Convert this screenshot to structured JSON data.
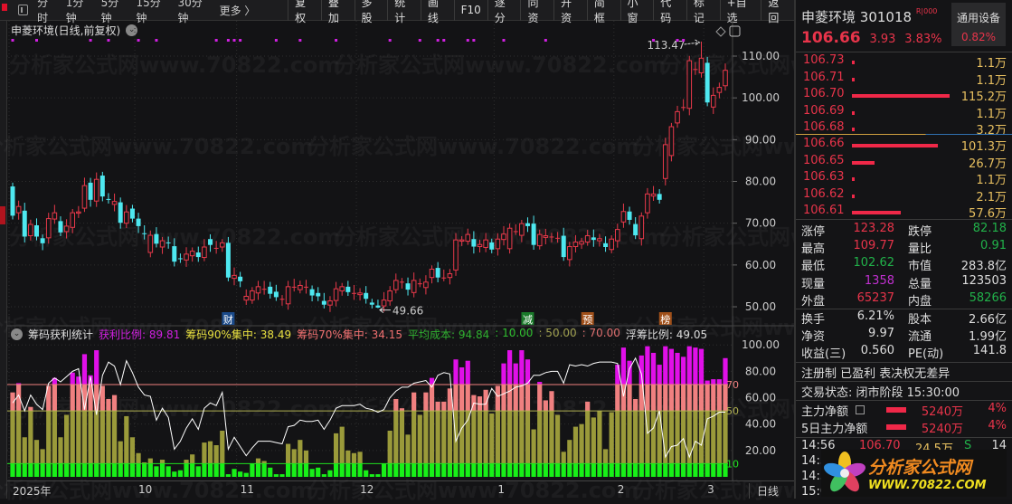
{
  "toolbar": {
    "periods": [
      "分时",
      "1分钟",
      "5分钟",
      "15分钟",
      "30分钟",
      "更多 〉"
    ],
    "buttons": [
      "复权",
      "叠加",
      "多股",
      "统计",
      "画线",
      "F10",
      "逐分",
      "同资",
      "开资",
      "简框",
      "小窗",
      "代码",
      "标记",
      "+自选",
      "返回"
    ]
  },
  "chart": {
    "title": "申菱环境(日线,前复权)",
    "y_ticks": [
      "110.00",
      "100.00",
      "90.00",
      "80.00",
      "70.00",
      "60.00",
      "50.00"
    ],
    "high_label": "113.47",
    "low_label": "49.66",
    "markers": [
      {
        "text": "财",
        "color": "#1a4a8a",
        "index": 36
      },
      {
        "text": "减",
        "color": "#1a7a2a",
        "index": 86
      },
      {
        "text": "预",
        "color": "#a0501a",
        "index": 96
      },
      {
        "text": "榜",
        "color": "#a0501a",
        "index": 109
      }
    ],
    "watermark": "分析家公式网www.70822.com"
  },
  "chart_data": [
    {
      "type": "candlestick",
      "title": "申菱环境(日线,前复权)",
      "ylim": [
        47,
        116
      ],
      "y_ticks": [
        110,
        100,
        90,
        80,
        70,
        60,
        50
      ],
      "ohlc_open_close": [
        [
          78.8,
          71.8
        ],
        [
          72.5,
          74
        ],
        [
          73,
          66.8
        ],
        [
          67,
          69.7
        ],
        [
          69.5,
          66.8
        ],
        [
          66.4,
          65.2
        ],
        [
          66.5,
          71.1
        ],
        [
          71,
          72.5
        ],
        [
          70.5,
          67.8
        ],
        [
          68,
          69.3
        ],
        [
          69,
          72.5
        ],
        [
          72.4,
          72.7
        ],
        [
          73.6,
          79
        ],
        [
          79.7,
          75.6
        ],
        [
          75.3,
          80.5
        ],
        [
          81.4,
          76.4
        ],
        [
          75.8,
          75.6
        ],
        [
          74.5,
          75.2
        ],
        [
          75,
          70.1
        ],
        [
          70,
          72.7
        ],
        [
          73.5,
          71.1
        ],
        [
          71.1,
          69.3
        ],
        [
          67.6,
          67.5
        ],
        [
          63,
          67.1
        ],
        [
          67.4,
          65.1
        ],
        [
          64.3,
          65.8
        ],
        [
          65.4,
          65.3
        ],
        [
          64.5,
          60.8
        ],
        [
          61.6,
          61.4
        ],
        [
          61.2,
          62.6
        ],
        [
          62.2,
          63.3
        ],
        [
          63,
          61.9
        ],
        [
          61.8,
          64.3
        ],
        [
          66.2,
          64.8
        ],
        [
          64.1,
          64.1
        ],
        [
          64.3,
          65.3
        ],
        [
          65.3,
          57
        ],
        [
          56.8,
          57.5
        ],
        [
          57.2,
          56.1
        ],
        [
          51.6,
          52.5
        ],
        [
          51.6,
          53.8
        ],
        [
          53.3,
          54.8
        ],
        [
          54.3,
          54.3
        ],
        [
          54.8,
          53.1
        ],
        [
          53.6,
          52.3
        ],
        [
          51.9,
          51.9
        ],
        [
          50.7,
          54.8
        ],
        [
          54.8,
          54.8
        ],
        [
          54.1,
          55.1
        ],
        [
          54.8,
          54.8
        ],
        [
          54.2,
          52.7
        ],
        [
          53.3,
          52.5
        ],
        [
          51.4,
          50.5
        ],
        [
          50.4,
          51.4
        ],
        [
          51.5,
          54.3
        ],
        [
          53.8,
          54.8
        ],
        [
          54.8,
          53.5
        ],
        [
          53.3,
          53.3
        ],
        [
          52.9,
          53.3
        ],
        [
          53.3,
          51.9
        ],
        [
          51.0,
          50.5
        ],
        [
          50.3,
          49.8
        ],
        [
          50.2,
          51.6
        ],
        [
          51.4,
          53.8
        ],
        [
          54.1,
          56.3
        ],
        [
          56,
          56
        ],
        [
          55.6,
          54.1
        ],
        [
          53.4,
          56.3
        ],
        [
          55.6,
          55.6
        ],
        [
          54.6,
          55.9
        ],
        [
          57,
          59
        ],
        [
          59.3,
          57
        ],
        [
          57,
          57
        ],
        [
          57,
          57.9
        ],
        [
          58.8,
          66
        ],
        [
          65.7,
          66
        ],
        [
          65.7,
          67.3
        ],
        [
          66.2,
          64.4
        ],
        [
          64.4,
          64.9
        ],
        [
          64.2,
          66
        ],
        [
          65.4,
          63.7
        ],
        [
          63.9,
          66.2
        ],
        [
          66.1,
          67.4
        ],
        [
          63.9,
          68.8
        ],
        [
          68.1,
          68.1
        ],
        [
          67.1,
          69.9
        ],
        [
          70,
          69.3
        ],
        [
          69.9,
          64.8
        ],
        [
          64.6,
          67.3
        ],
        [
          66.6,
          67
        ],
        [
          66.8,
          66.8
        ],
        [
          66.5,
          66.5
        ],
        [
          67,
          61.9
        ],
        [
          61.3,
          64.4
        ],
        [
          64.4,
          65.5
        ],
        [
          65,
          65.6
        ],
        [
          65.5,
          67
        ],
        [
          66.6,
          66
        ],
        [
          65.8,
          66.3
        ],
        [
          65.2,
          64.3
        ],
        [
          63.7,
          66.2
        ],
        [
          65.8,
          68.5
        ],
        [
          70.3,
          72.8
        ],
        [
          72.8,
          70.8
        ],
        [
          69.8,
          67.1
        ],
        [
          66.3,
          71.7
        ],
        [
          72.5,
          77
        ],
        [
          76.5,
          77
        ],
        [
          77,
          75.6
        ],
        [
          80.7,
          88.8
        ],
        [
          86.2,
          93.1
        ],
        [
          94,
          96.7
        ],
        [
          97.8,
          97.8
        ],
        [
          97.5,
          108.9
        ],
        [
          106.9,
          106.9
        ],
        [
          106,
          109.5
        ],
        [
          108.4,
          98.9
        ],
        [
          97.8,
          100.6
        ],
        [
          101.3,
          102.5
        ],
        [
          102.9,
          106.6
        ]
      ],
      "max_high": {
        "index": 115,
        "value": 113.47
      },
      "min_low": {
        "index": 61,
        "value": 49.66
      },
      "signal_indices": [
        0,
        4,
        13,
        16,
        21,
        24,
        34,
        36,
        37,
        38,
        44,
        48,
        54,
        63,
        68,
        71,
        72,
        76,
        77,
        82,
        89,
        107,
        111,
        112
      ],
      "x_labels": [
        {
          "text": "2025年",
          "index": 0
        },
        {
          "text": "10",
          "index": 21
        },
        {
          "text": "11",
          "index": 38
        },
        {
          "text": "12",
          "index": 58
        },
        {
          "text": "1",
          "index": 81
        },
        {
          "text": "2",
          "index": 101
        },
        {
          "text": "3",
          "index": 116
        }
      ],
      "period_label": "日线"
    },
    {
      "type": "bar+line",
      "title": "筹码获利统计",
      "ylim": [
        0,
        105
      ],
      "y_ticks": [
        "100.00",
        "80.00",
        "60.00",
        "40.00",
        "20.00"
      ],
      "ref_lines": [
        {
          "value": 70,
          "label": "70",
          "color": "#f08080"
        },
        {
          "value": 50,
          "label": "50",
          "color": "#b0b050"
        },
        {
          "value": 10,
          "label": "10",
          "color": "#20e020"
        }
      ],
      "bar_values": [
        64,
        71,
        30,
        53,
        28,
        21,
        69,
        75,
        30,
        47,
        79,
        76,
        93,
        77,
        96,
        69,
        59,
        62,
        27,
        46,
        30,
        18,
        11,
        14,
        8,
        13,
        8,
        4,
        5,
        13,
        17,
        8,
        26,
        27,
        24,
        35,
        2,
        6,
        4,
        3,
        10,
        14,
        12,
        7,
        2,
        2,
        25,
        21,
        28,
        20,
        6,
        7,
        2,
        5,
        33,
        38,
        20,
        18,
        19,
        5,
        2,
        2,
        10,
        35,
        59,
        52,
        32,
        64,
        47,
        64,
        75,
        57,
        57,
        67,
        89,
        83,
        88,
        62,
        61,
        66,
        48,
        69,
        86,
        96,
        86,
        96,
        89,
        36,
        72,
        58,
        65,
        47,
        19,
        28,
        38,
        40,
        57,
        45,
        50,
        21,
        49,
        85,
        98,
        88,
        59,
        92,
        99,
        94,
        85,
        99,
        97,
        94,
        91,
        99,
        98,
        97,
        73,
        74,
        74,
        90
      ],
      "line_values": [
        56,
        62,
        50,
        62,
        55,
        51,
        71,
        75,
        72,
        76,
        80,
        82,
        51,
        76,
        47,
        77,
        87,
        84,
        70,
        88,
        79,
        68,
        62,
        61,
        43,
        52,
        45,
        21,
        27,
        37,
        44,
        36,
        52,
        56,
        54,
        64,
        21,
        30,
        23,
        16,
        22,
        27,
        27,
        27,
        26,
        25,
        38,
        39,
        43,
        42,
        42,
        43,
        36,
        43,
        52,
        54,
        54,
        54,
        55,
        52,
        51,
        49,
        51,
        60,
        65,
        68,
        68,
        71,
        72,
        73,
        68,
        77,
        79,
        78,
        27,
        37,
        43,
        56,
        55,
        55,
        67,
        61,
        63,
        65,
        68,
        69,
        71,
        77,
        77,
        79,
        80,
        80,
        71,
        85,
        84,
        85,
        84,
        86,
        87,
        87,
        87,
        86,
        61,
        82,
        90,
        78,
        33,
        37,
        50,
        15,
        23,
        24,
        29,
        15,
        27,
        24,
        44,
        46,
        49,
        49
      ],
      "colors": {
        "green": "#18f018",
        "olive": "#9a9a3a",
        "salmon": "#f08080",
        "magenta": "#e010e8",
        "line": "#ffffff"
      }
    }
  ],
  "indicator": {
    "name": "筹码获利统计",
    "items": [
      {
        "label": "获利比例: 89.81",
        "color": "#d020e0"
      },
      {
        "label": "筹码90%集中: 38.49",
        "color": "#e8e040"
      },
      {
        "label": "筹码70%集中: 34.15",
        "color": "#f07070"
      },
      {
        "label": "平均成本: 94.84",
        "color": "#30b030"
      },
      {
        "label": ": 10.00",
        "color": "#30c030"
      },
      {
        "label": ": 50.00",
        "color": "#a0a050"
      },
      {
        "label": ": 70.00",
        "color": "#e07070"
      },
      {
        "label": "浮筹比例: 49.05",
        "color": "#dddddd"
      }
    ]
  },
  "quote": {
    "name": "申菱环境",
    "code": "301018",
    "badge": "R|000",
    "sector": "通用设备",
    "sector_change": "0.82%",
    "price": "106.66",
    "change": "3.93",
    "change_pct": "3.83%",
    "asks": [
      {
        "price": "106.73",
        "vol": "1.1万",
        "ratio": 0.01
      },
      {
        "price": "106.71",
        "vol": "1.1万",
        "ratio": 0.01
      },
      {
        "price": "106.70",
        "vol": "115.2万",
        "ratio": 1.0
      },
      {
        "price": "106.69",
        "vol": "1.1万",
        "ratio": 0.01
      },
      {
        "price": "106.68",
        "vol": "3.2万",
        "ratio": 0.01
      }
    ],
    "bids": [
      {
        "price": "106.66",
        "vol": "101.3万",
        "ratio": 0.88
      },
      {
        "price": "106.65",
        "vol": "26.7万",
        "ratio": 0.23
      },
      {
        "price": "106.63",
        "vol": "1.1万",
        "ratio": 0.01
      },
      {
        "price": "106.62",
        "vol": "2.1万",
        "ratio": 0.01
      },
      {
        "price": "106.61",
        "vol": "57.6万",
        "ratio": 0.5
      }
    ],
    "stats": [
      {
        "l1": "涨停",
        "v1": "123.28",
        "c1": "red",
        "l2": "跌停",
        "v2": "82.18",
        "c2": "green"
      },
      {
        "l1": "最高",
        "v1": "109.77",
        "c1": "red",
        "l2": "量比",
        "v2": "0.91",
        "c2": "green"
      },
      {
        "l1": "最低",
        "v1": "102.62",
        "c1": "green",
        "l2": "市值",
        "v2": "283.8亿",
        "c2": "white"
      },
      {
        "l1": "现量",
        "v1": "1358",
        "c1": "mag",
        "l2": "总量",
        "v2": "123503",
        "c2": "white"
      },
      {
        "l1": "外盘",
        "v1": "65237",
        "c1": "red",
        "l2": "内盘",
        "v2": "58266",
        "c2": "green"
      }
    ],
    "stats2": [
      {
        "l1": "换手",
        "v1": "6.21%",
        "l2": "股本",
        "v2": "2.66亿"
      },
      {
        "l1": "净资",
        "v1": "9.97",
        "l2": "流通",
        "v2": "1.99亿"
      },
      {
        "l1": "收益(三)",
        "v1": "0.560",
        "l2": "PE(动)",
        "v2": "141.8"
      }
    ],
    "tags": "注册制 已盈利 表决权无差异",
    "status": "交易状态: 闭市阶段 15:30:00",
    "flows": [
      {
        "label": "主力净额",
        "amount": "5240万",
        "pct": "4%"
      },
      {
        "label": "5日主力净额",
        "amount": "5240万",
        "pct": "4%"
      }
    ],
    "ticks": [
      {
        "time": "14:56",
        "price": "106.70",
        "vol": "24.5万",
        "side": "S",
        "count": "14"
      },
      {
        "time": "14:5"
      },
      {
        "time": "14:5"
      },
      {
        "time": "15:0"
      }
    ]
  },
  "logo": {
    "text": "分析家公式网",
    "url_text": "WWW.70822.COM"
  }
}
